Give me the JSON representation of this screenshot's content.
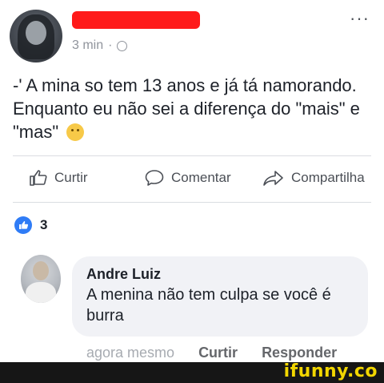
{
  "post": {
    "time": "3 min",
    "separator": "·",
    "text": "-' A mina so tem 13 anos e já tá namorando. Enquanto eu não sei a diferença do \"mais\" e \"mas\"",
    "emoji": "thinking-face"
  },
  "actions": {
    "like": "Curtir",
    "comment": "Comentar",
    "share": "Compartilha"
  },
  "reactions": {
    "count": "3"
  },
  "comment": {
    "author": "Andre Luiz",
    "text": "A menina não tem culpa se você é burra",
    "time": "agora mesmo",
    "like": "Curtir",
    "reply": "Responder"
  },
  "watermark": "ifunny.co",
  "colors": {
    "redaction": "#ff1a1a",
    "like_blue": "#2f7cf6",
    "footer_bg": "#161616",
    "watermark": "#f2d600"
  }
}
